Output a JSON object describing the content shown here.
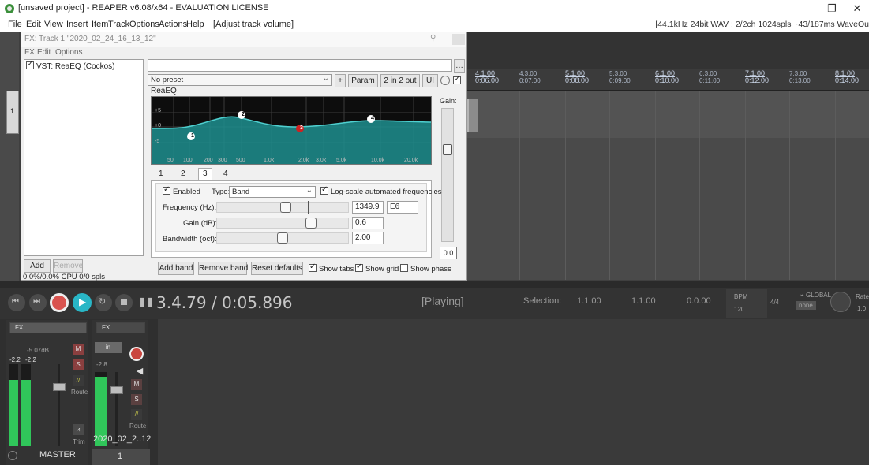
{
  "window": {
    "title": "[unsaved project] - REAPER v6.08/x64 - EVALUATION LICENSE",
    "minimize": "–",
    "restore": "❐",
    "close": "✕"
  },
  "menu": {
    "items": [
      "File",
      "Edit",
      "View",
      "Insert",
      "Item",
      "Track",
      "Options",
      "Actions",
      "Help",
      "[Adjust track volume]"
    ],
    "status": "[44.1kHz 24bit WAV : 2/2ch 1024spls ~43/187ms WaveOu"
  },
  "fx_window": {
    "title": "FX: Track 1 \"2020_02_24_16_13_12\"",
    "menu": [
      "FX",
      "Edit",
      "Options"
    ],
    "fx_list": [
      {
        "label": "VST: ReaEQ (Cockos)",
        "enabled": true
      }
    ],
    "add_label": "Add",
    "remove_label": "Remove",
    "cpu": "0.0%/0.0% CPU 0/0 spls",
    "preset": "No preset",
    "plus_label": "+",
    "param_label": "Param",
    "io_label": "2 in 2 out",
    "ui_label": "UI",
    "plugin_name": "ReaEQ",
    "graph": {
      "db_labels": [
        "+5",
        "+0",
        "-5"
      ],
      "freq_labels": [
        "50",
        "100",
        "200",
        "300",
        "500",
        "1.0k",
        "2.0k",
        "3.0k",
        "5.0k",
        "10.0k",
        "20.0k"
      ],
      "band_markers": [
        "1",
        "2",
        "3",
        "4"
      ],
      "curve_color": "#1f8f8f",
      "selected_band_color": "#cc2222"
    },
    "gain_label": "Gain:",
    "gain_value": "0.0",
    "tabs": [
      "1",
      "2",
      "3",
      "4"
    ],
    "active_tab": "3",
    "enabled_label": "Enabled",
    "enabled": true,
    "type_label": "Type:",
    "type_value": "Band",
    "log_scale_label": "Log-scale automated frequencies",
    "log_scale": true,
    "frequency_label": "Frequency (Hz):",
    "frequency_value": "1349.9",
    "note_value": "E6",
    "gain_db_label": "Gain (dB):",
    "gain_db_value": "0.6",
    "bandwidth_label": "Bandwidth (oct):",
    "bandwidth_value": "2.00",
    "add_band": "Add band",
    "remove_band": "Remove band",
    "reset_defaults": "Reset defaults",
    "show_tabs_label": "Show tabs",
    "show_tabs": true,
    "show_grid_label": "Show grid",
    "show_grid": true,
    "show_phase_label": "Show phase",
    "show_phase": false
  },
  "ruler": {
    "major": [
      {
        "bar": "4.1.00",
        "time": "0:06.00"
      },
      {
        "bar": "5.1.00",
        "time": "0:08.00"
      },
      {
        "bar": "6.1.00",
        "time": "0:10.00"
      },
      {
        "bar": "7.1.00",
        "time": "0:12.00"
      },
      {
        "bar": "8.1.00",
        "time": "0:14.00"
      }
    ],
    "minor": [
      {
        "bar": "4.3.00",
        "time": "0:07.00"
      },
      {
        "bar": "5.3.00",
        "time": "0:09.00"
      },
      {
        "bar": "6.3.00",
        "time": "0:11.00"
      },
      {
        "bar": "7.3.00",
        "time": "0:13.00"
      }
    ]
  },
  "track": {
    "number": "1"
  },
  "transport": {
    "time": "3.4.79 / 0:05.896",
    "state": "[Playing]",
    "selection_label": "Selection:",
    "sel_start": "1.1.00",
    "sel_end": "1.1.00",
    "sel_length": "0.0.00",
    "bpm_label": "BPM",
    "bpm": "120",
    "timesig": "4/4",
    "global_label": "GLOBAL",
    "global_value": "none",
    "rate_label": "Rate",
    "rate_value": "1.0"
  },
  "mixer": {
    "master": {
      "fx_label": "FX",
      "volume": "-5.07dB",
      "peak_l": "-2.2",
      "peak_r": "-2.2",
      "m_label": "M",
      "s_label": "S",
      "route_label": "Route",
      "trim_label": "Trim",
      "name": "MASTER"
    },
    "track1": {
      "fx_label": "FX",
      "in_label": "in",
      "db_label": "-2.8",
      "m_label": "M",
      "s_label": "S",
      "route_label": "Route",
      "name": "2020_02_2..12",
      "number": "1"
    }
  }
}
